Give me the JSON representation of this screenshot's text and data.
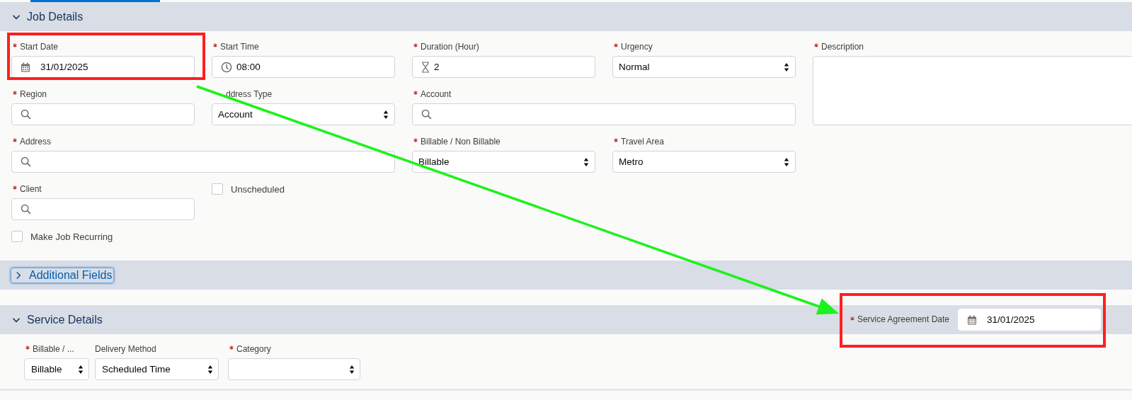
{
  "job_details": {
    "title": "Job Details",
    "expanded": true,
    "fields": [
      {
        "kind": "date",
        "label": "Start Date",
        "required": true,
        "value": "31/01/2025"
      },
      {
        "kind": "time",
        "label": "Start Time",
        "required": true,
        "value": "08:00"
      },
      {
        "kind": "duration",
        "label": "Duration (Hour)",
        "required": true,
        "value": "2"
      },
      {
        "kind": "select",
        "label": "Urgency",
        "required": true,
        "value": "Normal"
      },
      {
        "kind": "textarea",
        "label": "Description",
        "required": true
      },
      {
        "kind": "lookup",
        "label": "Region",
        "required": true
      },
      {
        "kind": "select",
        "label": "ddress Type",
        "required": false,
        "value": "Account"
      },
      {
        "kind": "lookup",
        "label": "Account",
        "required": true
      },
      {
        "kind": "lookup",
        "label": "Address",
        "required": true
      },
      {
        "kind": "select",
        "label": "Billable / Non Billable",
        "required": true,
        "value": "Billable"
      },
      {
        "kind": "select",
        "label": "Travel Area",
        "required": true,
        "value": "Metro"
      },
      {
        "kind": "lookup",
        "label": "Client",
        "required": true
      },
      {
        "kind": "checkbox",
        "label": "Unscheduled",
        "checked": false
      },
      {
        "kind": "checkbox",
        "label": "Make Job Recurring",
        "checked": false
      }
    ]
  },
  "additional_fields": {
    "title": "Additional Fields",
    "expanded": false
  },
  "service_details": {
    "title": "Service Details",
    "expanded": true,
    "agreement_date": {
      "label": "Service Agreement Date",
      "required": true,
      "value": "31/01/2025"
    },
    "fields": [
      {
        "kind": "select",
        "label": "Billable / ...",
        "required": true,
        "value": "Billable"
      },
      {
        "kind": "select",
        "label": "Delivery Method",
        "required": false,
        "value": "Scheduled Time"
      },
      {
        "kind": "select",
        "label": "Category",
        "required": true
      }
    ]
  }
}
